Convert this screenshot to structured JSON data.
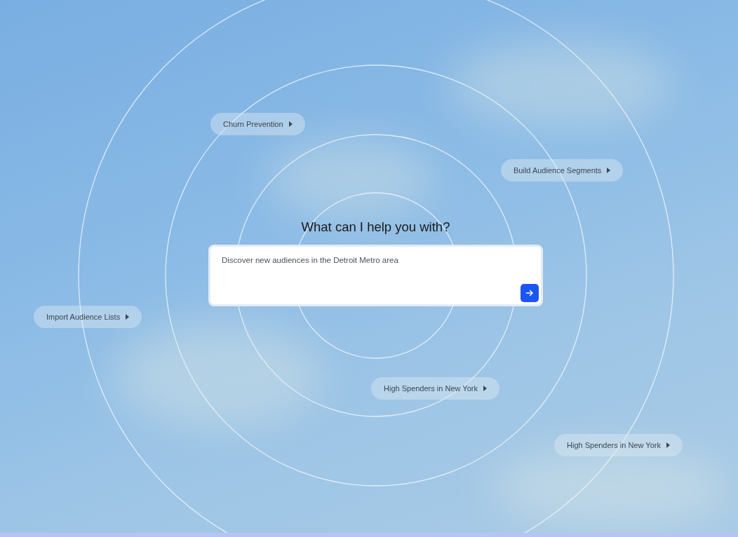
{
  "heading": "What can I help you with?",
  "prompt": {
    "value": "Discover new audiences in the Detroit Metro area"
  },
  "suggestions": [
    {
      "label": "Churn Prevention"
    },
    {
      "label": "Build Audience Segments"
    },
    {
      "label": "Import Audience Lists"
    },
    {
      "label": "High Spenders in New York"
    },
    {
      "label": "High Spenders in New York"
    }
  ]
}
